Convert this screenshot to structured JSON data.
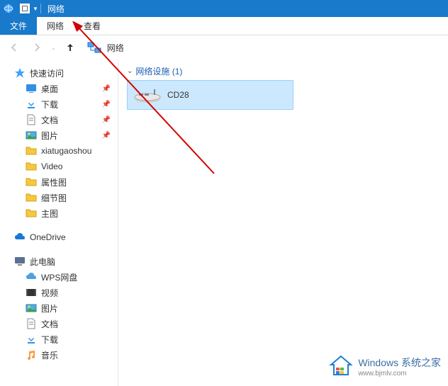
{
  "title": "网络",
  "tabs": {
    "file": "文件",
    "network": "网络",
    "view": "查看"
  },
  "breadcrumb": "网络",
  "sidebar": {
    "quick": "快速访问",
    "desktop": "桌面",
    "downloads": "下载",
    "documents": "文档",
    "pictures": "图片",
    "folder1": "xiatugaoshou",
    "folder2": "Video",
    "folder3": "属性图",
    "folder4": "细节图",
    "folder5": "主图",
    "onedrive": "OneDrive",
    "thispc": "此电脑",
    "wps": "WPS网盘",
    "video": "视频",
    "pictures2": "图片",
    "documents2": "文档",
    "downloads2": "下载",
    "music": "音乐"
  },
  "content": {
    "group_label": "网络设施 (1)",
    "item1": "CD28"
  },
  "watermark": {
    "brand": "Windows",
    "site": "系统之家",
    "url": "www.bjmlv.com"
  }
}
